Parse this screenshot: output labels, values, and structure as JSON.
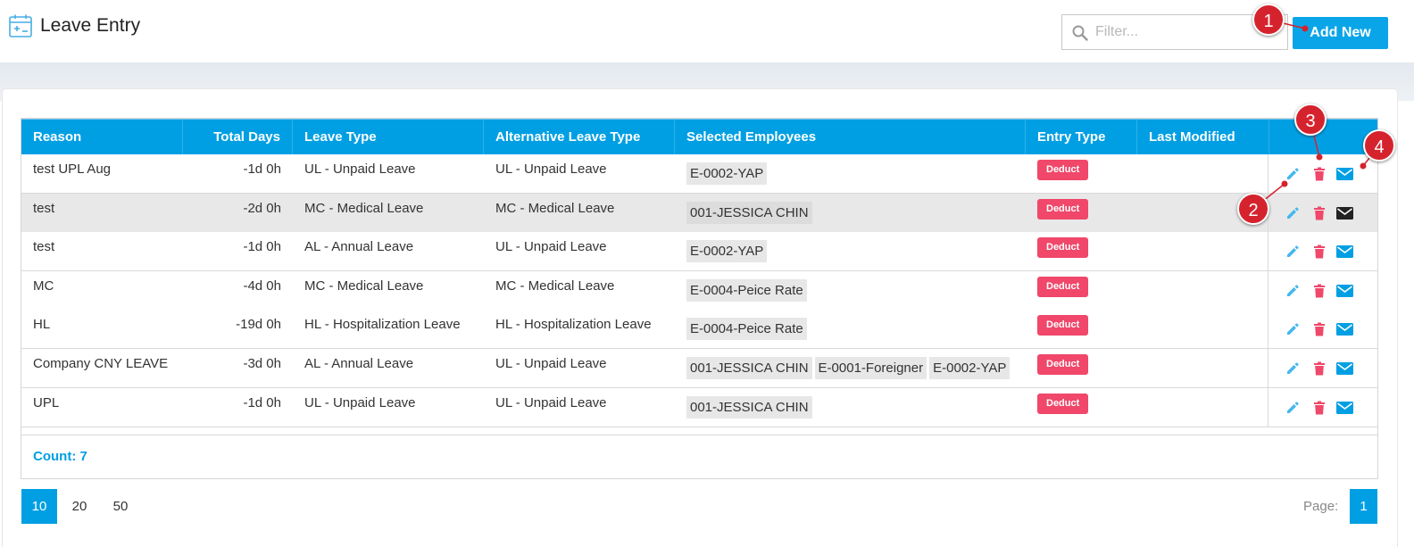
{
  "header": {
    "title": "Leave Entry",
    "filter_placeholder": "Filter...",
    "add_button_label": "Add New"
  },
  "table": {
    "columns": [
      "Reason",
      "Total Days",
      "Leave Type",
      "Alternative Leave Type",
      "Selected Employees",
      "Entry Type",
      "Last Modified",
      ""
    ],
    "rows": [
      {
        "reason": "test UPL Aug",
        "total_days": "-1d 0h",
        "leave_type": "UL - Unpaid Leave",
        "alt_leave_type": "UL - Unpaid Leave",
        "employees": [
          "E-0002-YAP"
        ],
        "entry_type": "Deduct",
        "last_modified": ""
      },
      {
        "reason": "test",
        "total_days": "-2d 0h",
        "leave_type": "MC - Medical Leave",
        "alt_leave_type": "MC - Medical Leave",
        "employees": [
          "001-JESSICA CHIN"
        ],
        "entry_type": "Deduct",
        "last_modified": ""
      },
      {
        "reason": "test",
        "total_days": "-1d 0h",
        "leave_type": "AL - Annual Leave",
        "alt_leave_type": "UL - Unpaid Leave",
        "employees": [
          "E-0002-YAP"
        ],
        "entry_type": "Deduct",
        "last_modified": ""
      },
      {
        "reason": "MC",
        "total_days": "-4d 0h",
        "leave_type": "MC - Medical Leave",
        "alt_leave_type": "MC - Medical Leave",
        "employees": [
          "E-0004-Peice Rate"
        ],
        "entry_type": "Deduct",
        "last_modified": ""
      },
      {
        "reason": "HL",
        "total_days": "-19d 0h",
        "leave_type": "HL - Hospitalization Leave",
        "alt_leave_type": "HL - Hospitalization Leave",
        "employees": [
          "E-0004-Peice Rate"
        ],
        "entry_type": "Deduct",
        "last_modified": ""
      },
      {
        "reason": "Company CNY LEAVE",
        "total_days": "-3d 0h",
        "leave_type": "AL - Annual Leave",
        "alt_leave_type": "UL - Unpaid Leave",
        "employees": [
          "001-JESSICA CHIN",
          "E-0001-Foreigner",
          "E-0002-YAP"
        ],
        "entry_type": "Deduct",
        "last_modified": ""
      },
      {
        "reason": "UPL",
        "total_days": "-1d 0h",
        "leave_type": "UL - Unpaid Leave",
        "alt_leave_type": "UL - Unpaid Leave",
        "employees": [
          "001-JESSICA CHIN"
        ],
        "entry_type": "Deduct",
        "last_modified": ""
      }
    ],
    "row_actions": [
      "edit-icon",
      "delete-icon",
      "email-icon"
    ],
    "count_text": "Count: 7"
  },
  "pager": {
    "page_sizes": [
      "10",
      "20",
      "50"
    ],
    "active_page_size": "10",
    "page_label": "Page:",
    "current_page": "1"
  },
  "callouts": [
    "1",
    "2",
    "3",
    "4"
  ],
  "colors": {
    "accent": "#009fe3",
    "deduct_badge": "#f0476a",
    "delete_icon": "#f0476a",
    "edit_icon": "#43b7ee",
    "callout": "#d5232e"
  }
}
